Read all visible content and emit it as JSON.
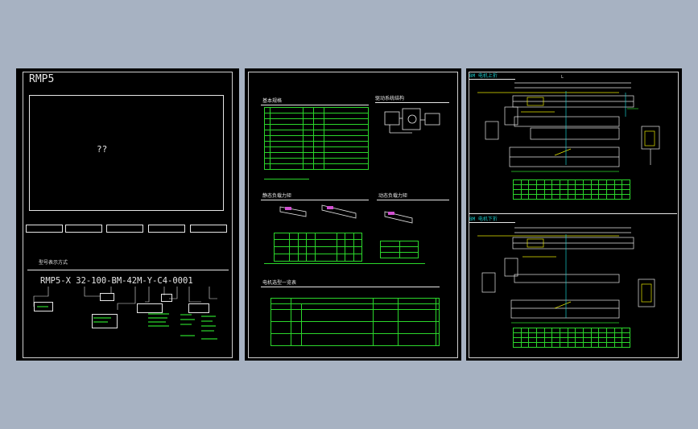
{
  "sheets": {
    "left": {
      "title": "RMP5",
      "image_placeholder": "??",
      "buttons": [
        "",
        "",
        "",
        "",
        ""
      ],
      "ordering_heading": "型号表示方式",
      "model_code": "RMP5-X 32-100-BM-42M-Y-C4-0001"
    },
    "middle": {
      "section1_title": "基本规格",
      "section2_title": "驱动系统结构",
      "section3_title": "静态负载力矩",
      "section4_title": "动态负载力矩",
      "section5_title": "电机选型一览表"
    },
    "right": {
      "top_title": "BM 电机上折",
      "bottom_title": "BM 电机下折",
      "label_L": "L"
    }
  },
  "colors": {
    "background": "#a7b2c2",
    "sheet": "#000000",
    "frame": "#cfcfcf",
    "green": "#2bd62b",
    "yellow": "#e6e600",
    "cyan": "#19c8c8",
    "white": "#e6e6e6"
  }
}
